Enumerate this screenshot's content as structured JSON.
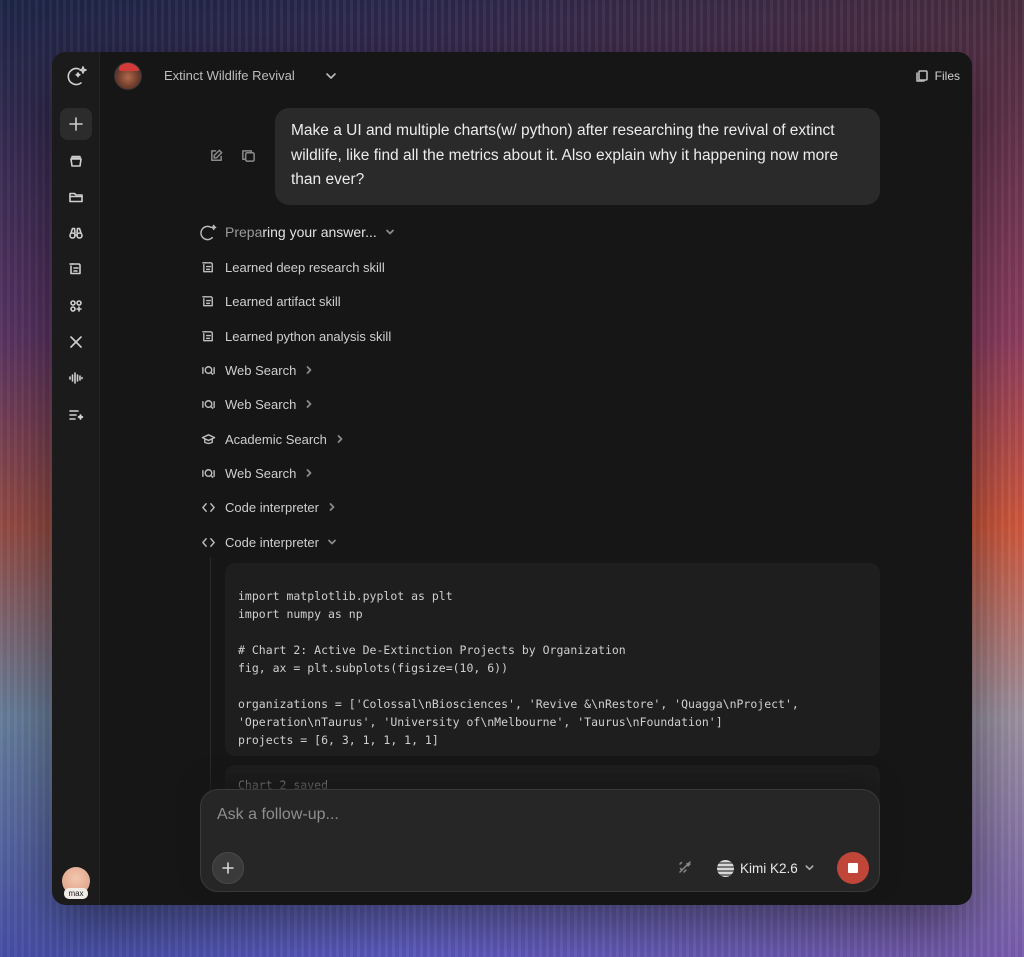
{
  "app": {
    "project_title": "Extinct Wildlife Revival",
    "files_label": "Files",
    "user_tag": "max"
  },
  "sidebar": {
    "items": [
      {
        "name": "logo-icon"
      },
      {
        "name": "new-chat-icon"
      },
      {
        "name": "stack-icon"
      },
      {
        "name": "folder-icon"
      },
      {
        "name": "binoculars-icon"
      },
      {
        "name": "skills-icon"
      },
      {
        "name": "agents-icon"
      },
      {
        "name": "x-icon"
      },
      {
        "name": "audio-wave-icon"
      },
      {
        "name": "list-sparkle-icon"
      }
    ]
  },
  "conversation": {
    "user_message": "Make a UI and multiple charts(w/ python) after researching the revival of extinct wildlife, like find all the metrics about it. Also explain why it happening now more than ever?",
    "status_prefix": "Prepa",
    "status_highlight": "ring your answer...",
    "steps": [
      {
        "label": "Learned deep research skill",
        "icon": "skill-icon"
      },
      {
        "label": "Learned artifact skill",
        "icon": "skill-icon"
      },
      {
        "label": "Learned python analysis skill",
        "icon": "skill-icon"
      },
      {
        "label": "Web Search",
        "icon": "web-search-icon"
      },
      {
        "label": "Web Search",
        "icon": "web-search-icon"
      },
      {
        "label": "Academic Search",
        "icon": "graduation-cap-icon"
      },
      {
        "label": "Web Search",
        "icon": "web-search-icon"
      },
      {
        "label": "Code interpreter",
        "icon": "code-icon"
      },
      {
        "label": "Code interpreter",
        "icon": "code-icon"
      }
    ],
    "code_lines": [
      "import matplotlib.pyplot as plt",
      "import numpy as np",
      "",
      "# Chart 2: Active De-Extinction Projects by Organization",
      "fig, ax = plt.subplots(figsize=(10, 6))",
      "",
      "organizations = ['Colossal\\nBiosciences', 'Revive &\\nRestore', 'Quagga\\nProject',",
      "'Operation\\nTaurus', 'University of\\nMelbourne', 'Taurus\\nFoundation']",
      "projects = [6, 3, 1, 1, 1, 1]"
    ],
    "code_output": "Chart 2 saved"
  },
  "composer": {
    "placeholder": "Ask a follow-up...",
    "model_name": "Kimi K2.6"
  },
  "colors": {
    "window_bg": "#161616",
    "stop_button": "#c0463a"
  }
}
